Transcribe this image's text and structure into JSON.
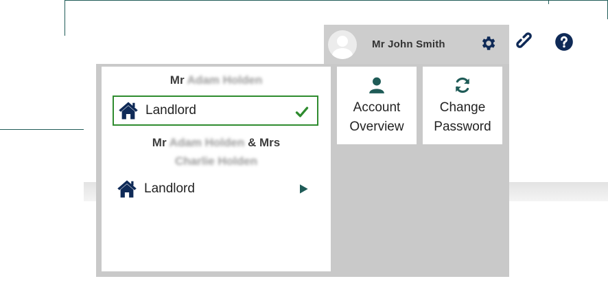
{
  "header": {
    "user_name": "Mr John Smith"
  },
  "accounts": [
    {
      "title_prefix": "Mr",
      "title_blurred": "Adam Holden",
      "role": "Landlord",
      "selected": true
    },
    {
      "title_prefix": "Mr",
      "title_blurred": "Adam Holden",
      "title_joiner": "& Mrs",
      "title_blurred_2": "Charlie Holden",
      "role": "Landlord",
      "selected": false
    }
  ],
  "tiles": [
    {
      "line1": "Account",
      "line2": "Overview",
      "icon": "person-icon"
    },
    {
      "line1": "Change",
      "line2": "Password",
      "icon": "refresh-icon"
    }
  ],
  "icons": {
    "settings": "gear-icon",
    "link": "link-icon",
    "help": "help-icon"
  },
  "colors": {
    "brand_navy": "#0f2a57",
    "accent_teal": "#1f5b57",
    "success_green": "#2e8b2e",
    "menu_grey": "#c9c9c9"
  }
}
